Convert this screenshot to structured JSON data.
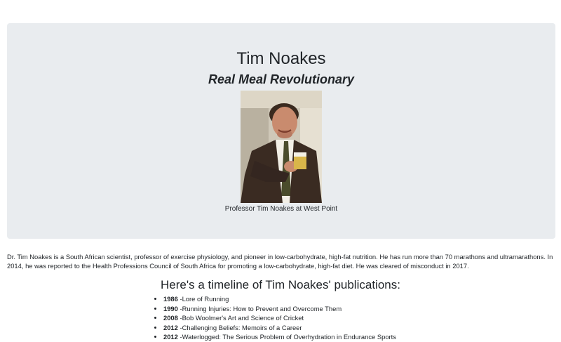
{
  "header": {
    "title": "Tim Noakes",
    "subtitle": "Real Meal Revolutionary"
  },
  "photo": {
    "caption": "Professor Tim Noakes at West Point"
  },
  "bio": {
    "text": "Dr. Tim Noakes is a South African scientist, professor of exercise physiology, and pioneer in low-carbohydrate, high-fat nutrition. He has run more than 70 marathons and ultramarathons. In 2014, he was reported to the Health Professions Council of South Africa for promoting a low-carbohydrate, high-fat diet. He was cleared of misconduct in 2017."
  },
  "timeline": {
    "heading": "Here's a timeline of Tim Noakes' publications:",
    "items": [
      {
        "year": "1986",
        "text": " -Lore of Running"
      },
      {
        "year": "1990",
        "text": " -Running Injuries: How to Prevent and Overcome Them"
      },
      {
        "year": "2008",
        "text": " -Bob Woolmer's Art and Science of Cricket"
      },
      {
        "year": "2012",
        "text": " -Challenging Beliefs: Memoirs of a Career"
      },
      {
        "year": "2012",
        "text": " -Waterlogged: The Serious Problem of Overhydration in Endurance Sports"
      }
    ]
  }
}
